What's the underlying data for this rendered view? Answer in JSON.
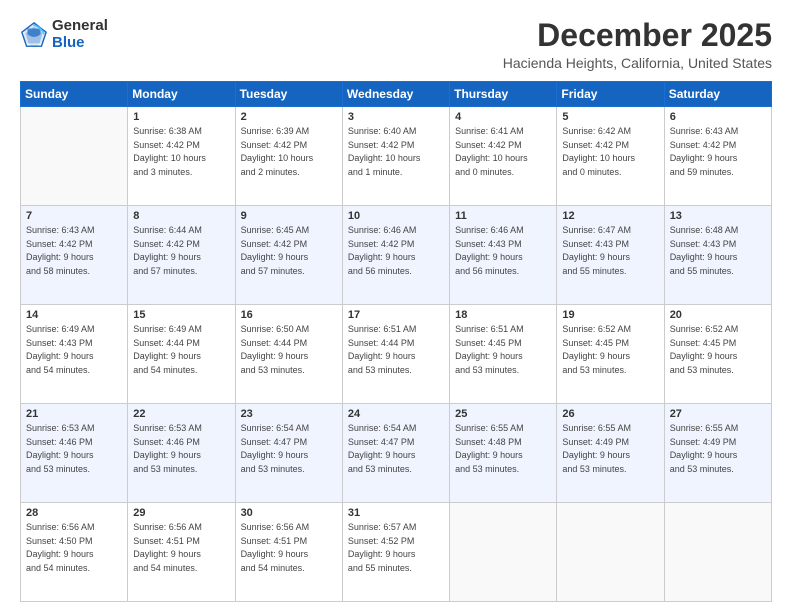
{
  "header": {
    "logo_general": "General",
    "logo_blue": "Blue",
    "title": "December 2025",
    "subtitle": "Hacienda Heights, California, United States"
  },
  "calendar": {
    "days_of_week": [
      "Sunday",
      "Monday",
      "Tuesday",
      "Wednesday",
      "Thursday",
      "Friday",
      "Saturday"
    ],
    "weeks": [
      [
        {
          "day": "",
          "info": ""
        },
        {
          "day": "1",
          "info": "Sunrise: 6:38 AM\nSunset: 4:42 PM\nDaylight: 10 hours\nand 3 minutes."
        },
        {
          "day": "2",
          "info": "Sunrise: 6:39 AM\nSunset: 4:42 PM\nDaylight: 10 hours\nand 2 minutes."
        },
        {
          "day": "3",
          "info": "Sunrise: 6:40 AM\nSunset: 4:42 PM\nDaylight: 10 hours\nand 1 minute."
        },
        {
          "day": "4",
          "info": "Sunrise: 6:41 AM\nSunset: 4:42 PM\nDaylight: 10 hours\nand 0 minutes."
        },
        {
          "day": "5",
          "info": "Sunrise: 6:42 AM\nSunset: 4:42 PM\nDaylight: 10 hours\nand 0 minutes."
        },
        {
          "day": "6",
          "info": "Sunrise: 6:43 AM\nSunset: 4:42 PM\nDaylight: 9 hours\nand 59 minutes."
        }
      ],
      [
        {
          "day": "7",
          "info": "Sunrise: 6:43 AM\nSunset: 4:42 PM\nDaylight: 9 hours\nand 58 minutes."
        },
        {
          "day": "8",
          "info": "Sunrise: 6:44 AM\nSunset: 4:42 PM\nDaylight: 9 hours\nand 57 minutes."
        },
        {
          "day": "9",
          "info": "Sunrise: 6:45 AM\nSunset: 4:42 PM\nDaylight: 9 hours\nand 57 minutes."
        },
        {
          "day": "10",
          "info": "Sunrise: 6:46 AM\nSunset: 4:42 PM\nDaylight: 9 hours\nand 56 minutes."
        },
        {
          "day": "11",
          "info": "Sunrise: 6:46 AM\nSunset: 4:43 PM\nDaylight: 9 hours\nand 56 minutes."
        },
        {
          "day": "12",
          "info": "Sunrise: 6:47 AM\nSunset: 4:43 PM\nDaylight: 9 hours\nand 55 minutes."
        },
        {
          "day": "13",
          "info": "Sunrise: 6:48 AM\nSunset: 4:43 PM\nDaylight: 9 hours\nand 55 minutes."
        }
      ],
      [
        {
          "day": "14",
          "info": "Sunrise: 6:49 AM\nSunset: 4:43 PM\nDaylight: 9 hours\nand 54 minutes."
        },
        {
          "day": "15",
          "info": "Sunrise: 6:49 AM\nSunset: 4:44 PM\nDaylight: 9 hours\nand 54 minutes."
        },
        {
          "day": "16",
          "info": "Sunrise: 6:50 AM\nSunset: 4:44 PM\nDaylight: 9 hours\nand 53 minutes."
        },
        {
          "day": "17",
          "info": "Sunrise: 6:51 AM\nSunset: 4:44 PM\nDaylight: 9 hours\nand 53 minutes."
        },
        {
          "day": "18",
          "info": "Sunrise: 6:51 AM\nSunset: 4:45 PM\nDaylight: 9 hours\nand 53 minutes."
        },
        {
          "day": "19",
          "info": "Sunrise: 6:52 AM\nSunset: 4:45 PM\nDaylight: 9 hours\nand 53 minutes."
        },
        {
          "day": "20",
          "info": "Sunrise: 6:52 AM\nSunset: 4:45 PM\nDaylight: 9 hours\nand 53 minutes."
        }
      ],
      [
        {
          "day": "21",
          "info": "Sunrise: 6:53 AM\nSunset: 4:46 PM\nDaylight: 9 hours\nand 53 minutes."
        },
        {
          "day": "22",
          "info": "Sunrise: 6:53 AM\nSunset: 4:46 PM\nDaylight: 9 hours\nand 53 minutes."
        },
        {
          "day": "23",
          "info": "Sunrise: 6:54 AM\nSunset: 4:47 PM\nDaylight: 9 hours\nand 53 minutes."
        },
        {
          "day": "24",
          "info": "Sunrise: 6:54 AM\nSunset: 4:47 PM\nDaylight: 9 hours\nand 53 minutes."
        },
        {
          "day": "25",
          "info": "Sunrise: 6:55 AM\nSunset: 4:48 PM\nDaylight: 9 hours\nand 53 minutes."
        },
        {
          "day": "26",
          "info": "Sunrise: 6:55 AM\nSunset: 4:49 PM\nDaylight: 9 hours\nand 53 minutes."
        },
        {
          "day": "27",
          "info": "Sunrise: 6:55 AM\nSunset: 4:49 PM\nDaylight: 9 hours\nand 53 minutes."
        }
      ],
      [
        {
          "day": "28",
          "info": "Sunrise: 6:56 AM\nSunset: 4:50 PM\nDaylight: 9 hours\nand 54 minutes."
        },
        {
          "day": "29",
          "info": "Sunrise: 6:56 AM\nSunset: 4:51 PM\nDaylight: 9 hours\nand 54 minutes."
        },
        {
          "day": "30",
          "info": "Sunrise: 6:56 AM\nSunset: 4:51 PM\nDaylight: 9 hours\nand 54 minutes."
        },
        {
          "day": "31",
          "info": "Sunrise: 6:57 AM\nSunset: 4:52 PM\nDaylight: 9 hours\nand 55 minutes."
        },
        {
          "day": "",
          "info": ""
        },
        {
          "day": "",
          "info": ""
        },
        {
          "day": "",
          "info": ""
        }
      ]
    ]
  }
}
